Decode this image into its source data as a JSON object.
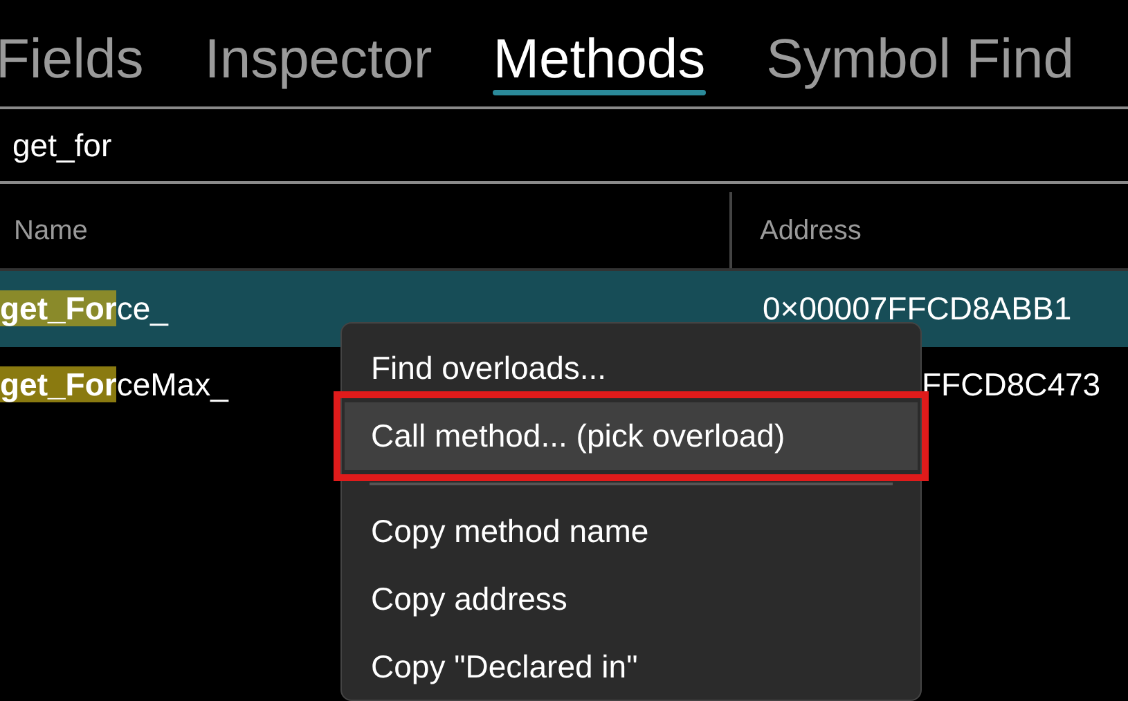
{
  "tabs": [
    {
      "label": "Fields",
      "selected": false
    },
    {
      "label": "Inspector",
      "selected": false
    },
    {
      "label": "Methods",
      "selected": true
    },
    {
      "label": "Symbol Find",
      "selected": false
    }
  ],
  "search": {
    "value": "get_for"
  },
  "table": {
    "columns": [
      "Name",
      "Address"
    ],
    "rows": [
      {
        "match": "get_For",
        "name_rest": "ce_",
        "address": "0×00007FFCD8ABB1",
        "selected": true
      },
      {
        "match": "get_For",
        "name_rest": "ceMax_",
        "address": "FFCD8C473",
        "selected": false
      }
    ]
  },
  "context_menu": {
    "items": [
      {
        "kind": "item",
        "label": "Find overloads...",
        "highlighted": false
      },
      {
        "kind": "item",
        "label": "Call method... (pick overload)",
        "highlighted": true
      },
      {
        "kind": "separator"
      },
      {
        "kind": "item",
        "label": "Copy method name",
        "highlighted": false
      },
      {
        "kind": "item",
        "label": "Copy address",
        "highlighted": false
      },
      {
        "kind": "item",
        "label": "Copy \"Declared in\"",
        "highlighted": false
      }
    ]
  }
}
